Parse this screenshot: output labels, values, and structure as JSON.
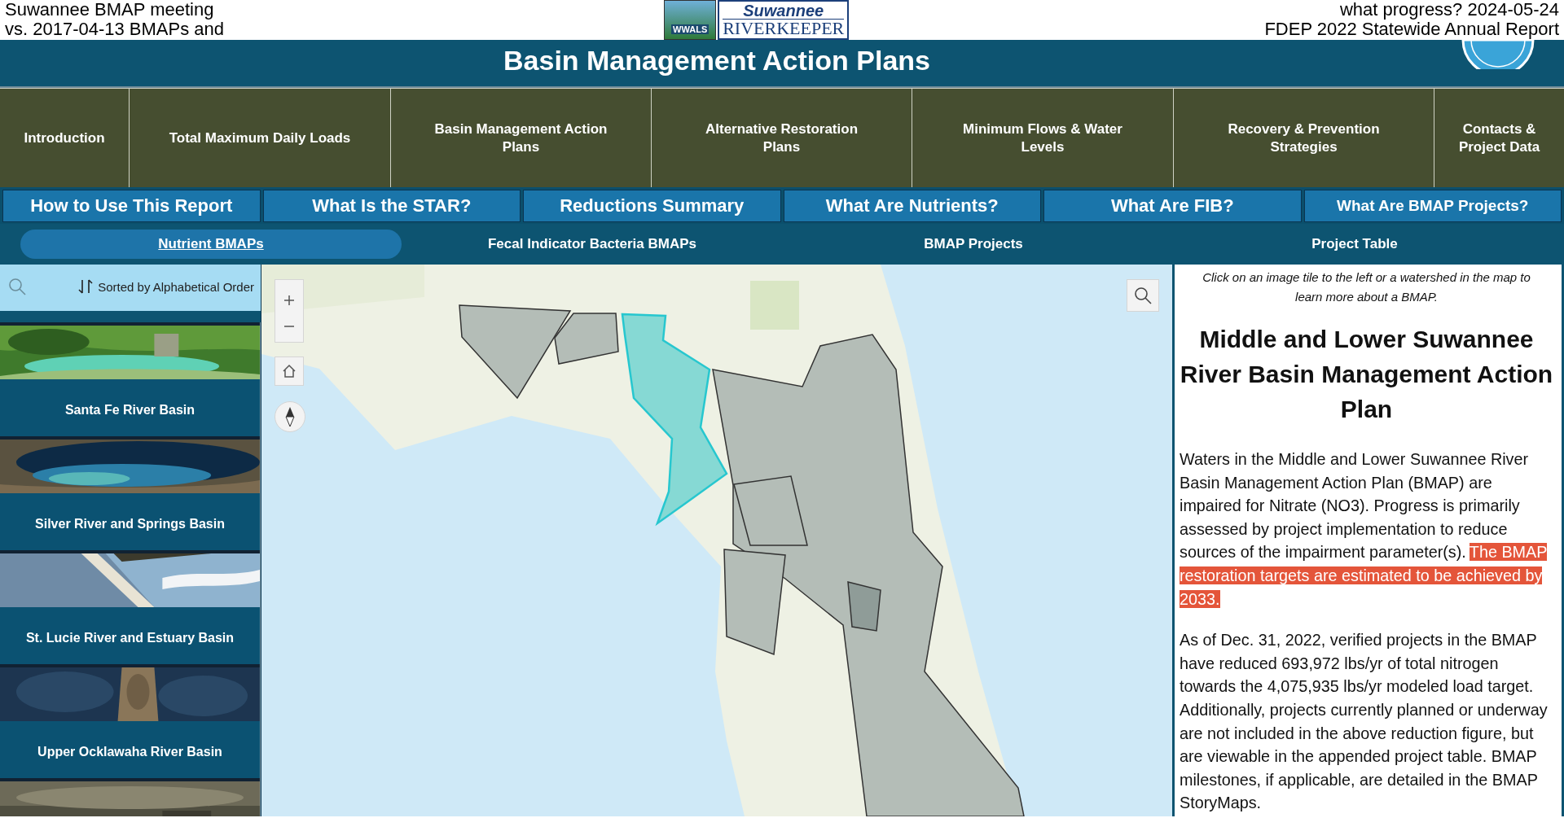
{
  "overlay_caption": {
    "left_lines": [
      "Suwannee BMAP meeting",
      "vs. 2017-04-13 BMAPs and"
    ],
    "right_lines": [
      "what progress? 2024-05-24",
      "FDEP 2022 Statewide Annual Report"
    ]
  },
  "logo": {
    "badge": "WWALS",
    "line1": "Suwannee",
    "line2": "RIVERKEEPER"
  },
  "title_bar": {
    "title": "Basin Management Action Plans"
  },
  "main_nav": [
    {
      "label": "Introduction"
    },
    {
      "label": "Total Maximum Daily Loads"
    },
    {
      "label": "Basin Management Action Plans"
    },
    {
      "label": "Alternative Restoration Plans"
    },
    {
      "label": "Minimum Flows & Water Levels"
    },
    {
      "label": "Recovery & Prevention Strategies"
    },
    {
      "label": "Contacts & Project Data"
    }
  ],
  "report_nav": [
    {
      "label": "How to Use This Report"
    },
    {
      "label": "What Is the STAR?"
    },
    {
      "label": "Reductions Summary"
    },
    {
      "label": "What Are Nutrients?"
    },
    {
      "label": "What Are FIB?"
    },
    {
      "label": "What Are BMAP Projects?"
    }
  ],
  "tabs": [
    {
      "label": "Nutrient BMAPs",
      "selected": true
    },
    {
      "label": "Fecal Indicator Bacteria BMAPs",
      "selected": false
    },
    {
      "label": "BMAP Projects",
      "selected": false
    },
    {
      "label": "Project Table",
      "selected": false
    }
  ],
  "sidebar": {
    "sort_label": "Sorted by Alphabetical Order",
    "tiles": [
      {
        "title": "Santa Fe River Basin"
      },
      {
        "title": "Silver River and Springs Basin"
      },
      {
        "title": "St. Lucie River and Estuary Basin"
      },
      {
        "title": "Upper Ocklawaha River Basin"
      },
      {
        "kind": "picture"
      }
    ]
  },
  "info_panel": {
    "hint": "Click on an image tile to the left or a watershed in the map to learn more about a BMAP.",
    "heading": "Middle and Lower Suwannee River Basin Management Action Plan",
    "paragraphs": [
      {
        "text": "Waters in the Middle and Lower Suwannee River Basin Management Action Plan (BMAP) are impaired for Nitrate (NO3). Progress is primarily assessed by project implementation to reduce sources of the impairment parameter(s).",
        "highlight": "The BMAP restoration targets are estimated to be achieved by 2033."
      },
      {
        "text": "As of Dec. 31, 2022, verified projects in the BMAP have reduced 693,972 lbs/yr of total nitrogen towards the 4,075,935 lbs/yr modeled load target. Additionally, projects currently planned or underway are not included in the above reduction figure, but are viewable in the appended project table. BMAP milestones, if applicable, are detailed in the BMAP StoryMaps."
      }
    ]
  }
}
